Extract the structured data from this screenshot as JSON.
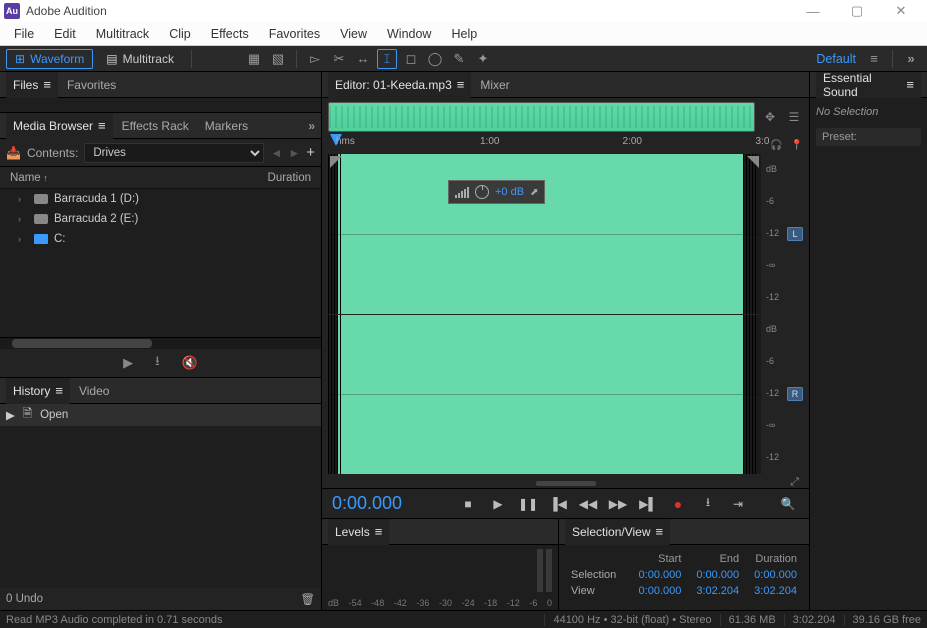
{
  "title_bar": {
    "logo_text": "Au",
    "title": "Adobe Audition"
  },
  "menu": [
    "File",
    "Edit",
    "Multitrack",
    "Clip",
    "Effects",
    "Favorites",
    "View",
    "Window",
    "Help"
  ],
  "toolbar": {
    "views": [
      {
        "label": "Waveform",
        "active": true
      },
      {
        "label": "Multitrack",
        "active": false
      }
    ],
    "workspace": "Default"
  },
  "files_panel": {
    "tabs": [
      {
        "label": "Files",
        "active": true
      },
      {
        "label": "Favorites",
        "active": false
      }
    ]
  },
  "media_browser": {
    "tabs": [
      {
        "label": "Media Browser",
        "active": true
      },
      {
        "label": "Effects Rack",
        "active": false
      },
      {
        "label": "Markers",
        "active": false
      }
    ],
    "contents_label": "Contents:",
    "contents_value": "Drives",
    "columns": {
      "name": "Name",
      "duration": "Duration"
    },
    "rows": [
      {
        "label": "Barracuda 1 (D:)",
        "icon": "drive"
      },
      {
        "label": "Barracuda 2 (E:)",
        "icon": "drive"
      },
      {
        "label": "C:",
        "icon": "pc"
      }
    ]
  },
  "history_panel": {
    "tabs": [
      {
        "label": "History",
        "active": true
      },
      {
        "label": "Video",
        "active": false
      }
    ],
    "entry": "Open",
    "footer": "0 Undo"
  },
  "editor": {
    "tabs": [
      {
        "label": "Editor: 01-Keeda.mp3",
        "active": true
      },
      {
        "label": "Mixer",
        "active": false
      }
    ],
    "time_marks": {
      "left": "hms",
      "t1": "1:00",
      "t2": "2:00",
      "t3": "3:0"
    },
    "amplitude_labels": [
      "dB",
      "-6",
      "-12",
      "-∞",
      "-12"
    ],
    "channel_badges": {
      "l": "L",
      "r": "R"
    },
    "hud_value": "+0 dB",
    "hud_unit": ""
  },
  "transport": {
    "timecode": "0:00.000"
  },
  "levels_panel": {
    "tab": "Levels",
    "scale": [
      "dB",
      "-54",
      "-48",
      "-42",
      "-36",
      "-30",
      "-24",
      "-18",
      "-12",
      "-6",
      "0"
    ]
  },
  "selview_panel": {
    "tab": "Selection/View",
    "headers": {
      "start": "Start",
      "end": "End",
      "duration": "Duration"
    },
    "rows": {
      "selection": {
        "label": "Selection",
        "start": "0:00.000",
        "end": "0:00.000",
        "duration": "0:00.000"
      },
      "view": {
        "label": "View",
        "start": "0:00.000",
        "end": "3:02.204",
        "duration": "3:02.204"
      }
    }
  },
  "essential_sound": {
    "tab": "Essential Sound",
    "no_selection": "No Selection",
    "preset_label": "Preset:"
  },
  "status_bar": {
    "left": "Read MP3 Audio completed in 0.71 seconds",
    "format": "44100 Hz • 32-bit (float) • Stereo",
    "size": "61.36 MB",
    "length": "3:02.204",
    "disk": "39.16 GB free"
  }
}
